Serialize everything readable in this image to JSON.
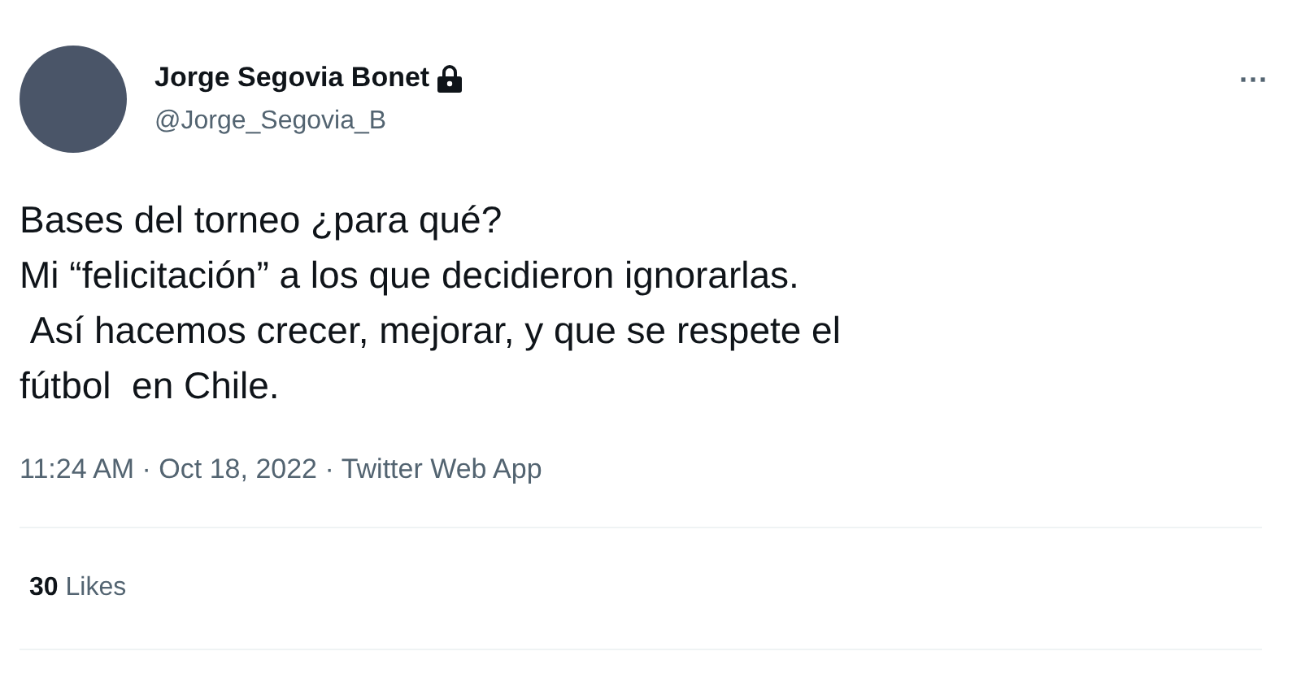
{
  "author": {
    "name": "Jorge Segovia Bonet",
    "protected": true,
    "handle": "@Jorge_Segovia_B"
  },
  "more_menu": "···",
  "text": "Bases del torneo ¿para qué?\nMi “felicitación” a los que decidieron ignorarlas.\n Así hacemos crecer, mejorar, y que se respete el\nfútbol  en Chile.",
  "meta": "11:24 AM · Oct 18, 2022 · Twitter Web App",
  "stats": [
    {
      "count": "30",
      "label": "Likes"
    }
  ]
}
